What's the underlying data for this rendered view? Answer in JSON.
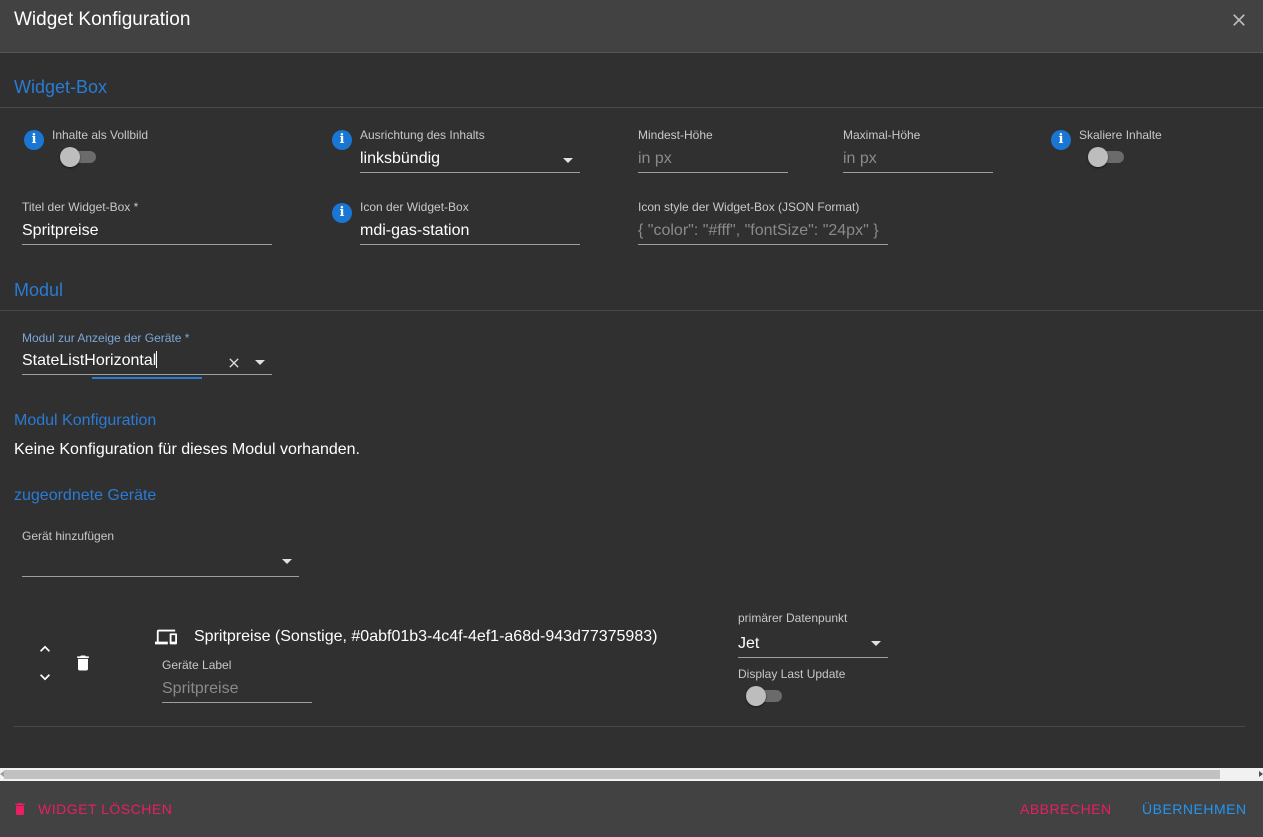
{
  "header": {
    "title": "Widget Konfiguration"
  },
  "widget_box": {
    "section_title": "Widget-Box",
    "fullscreen": {
      "label": "Inhalte als Vollbild",
      "checked": false
    },
    "alignment": {
      "label": "Ausrichtung des Inhalts",
      "value": "linksbündig"
    },
    "min_height": {
      "label": "Mindest-Höhe",
      "placeholder": "in px"
    },
    "max_height": {
      "label": "Maximal-Höhe",
      "placeholder": "in px"
    },
    "scale": {
      "label": "Skaliere Inhalte",
      "checked": false
    },
    "title": {
      "label": "Titel der Widget-Box",
      "required_mark": "*",
      "value": "Spritpreise"
    },
    "icon": {
      "label": "Icon der Widget-Box",
      "value": "mdi-gas-station"
    },
    "icon_style": {
      "label": "Icon style der Widget-Box (JSON Format)",
      "placeholder": "{ \"color\": \"#fff\", \"fontSize\": \"24px\" }"
    }
  },
  "module": {
    "section_title": "Modul",
    "select": {
      "label": "Modul zur Anzeige der Geräte",
      "required_mark": "*",
      "value": "StateListHorizontal"
    },
    "config_title": "Modul Konfiguration",
    "config_empty": "Keine Konfiguration für dieses Modul vorhanden.",
    "devices_title": "zugeordnete Geräte",
    "add_device": {
      "label": "Gerät hinzufügen",
      "value": ""
    }
  },
  "devices": [
    {
      "name": "Spritpreise (Sonstige, #0abf01b3-4c4f-4ef1-a68d-943d77375983)",
      "label_field": {
        "label": "Geräte Label",
        "placeholder": "Spritpreise"
      },
      "primary_dp": {
        "label": "primärer Datenpunkt",
        "value": "Jet"
      },
      "last_update": {
        "label": "Display Last Update",
        "checked": false
      }
    }
  ],
  "footer": {
    "delete_label": "Widget löschen",
    "cancel_label": "Abbrechen",
    "apply_label": "Übernehmen"
  },
  "colors": {
    "accent": "#2a7bd4",
    "danger": "#e91e63",
    "primary": "#2196f3",
    "info": "#1976d2"
  }
}
